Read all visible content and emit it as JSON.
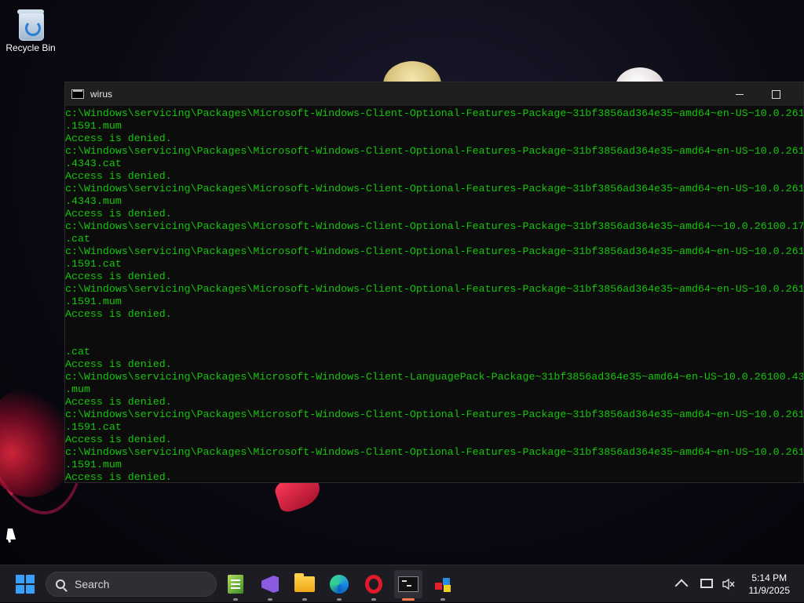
{
  "desktop": {
    "icons": [
      {
        "label": "Recycle Bin",
        "icon": "recycle-bin-icon"
      }
    ]
  },
  "window": {
    "title": "wirus",
    "icon": "console-icon",
    "lines": [
      "c:\\Windows\\servicing\\Packages\\Microsoft-Windows-Client-Optional-Features-Package~31bf3856ad364e35~amd64~en-US~10.0.261",
      ".1591.mum",
      "Access is denied.",
      "c:\\Windows\\servicing\\Packages\\Microsoft-Windows-Client-Optional-Features-Package~31bf3856ad364e35~amd64~en-US~10.0.261",
      ".4343.cat",
      "Access is denied.",
      "c:\\Windows\\servicing\\Packages\\Microsoft-Windows-Client-Optional-Features-Package~31bf3856ad364e35~amd64~en-US~10.0.261",
      ".4343.mum",
      "Access is denied.",
      "c:\\Windows\\servicing\\Packages\\Microsoft-Windows-Client-Optional-Features-Package~31bf3856ad364e35~amd64~~10.0.26100.17",
      ".cat",
      "c:\\Windows\\servicing\\Packages\\Microsoft-Windows-Client-Optional-Features-Package~31bf3856ad364e35~amd64~en-US~10.0.261",
      ".1591.cat",
      "Access is denied.",
      "c:\\Windows\\servicing\\Packages\\Microsoft-Windows-Client-Optional-Features-Package~31bf3856ad364e35~amd64~en-US~10.0.261",
      ".1591.mum",
      "Access is denied.",
      "",
      "",
      ".cat",
      "Access is denied.",
      "c:\\Windows\\servicing\\Packages\\Microsoft-Windows-Client-LanguagePack-Package~31bf3856ad364e35~amd64~en-US~10.0.26100.43",
      ".mum",
      "Access is denied.",
      "c:\\Windows\\servicing\\Packages\\Microsoft-Windows-Client-Optional-Features-Package~31bf3856ad364e35~amd64~en-US~10.0.261",
      ".1591.cat",
      "Access is denied.",
      "c:\\Windows\\servicing\\Packages\\Microsoft-Windows-Client-Optional-Features-Package~31bf3856ad364e35~amd64~en-US~10.0.261",
      ".1591.mum",
      "Access is denied."
    ],
    "colors": {
      "text": "#16c60c",
      "background": "#0c0c0c"
    }
  },
  "taskbar": {
    "search_placeholder": "Search",
    "apps": [
      {
        "name": "notepad-app",
        "icon": "notepad-icon"
      },
      {
        "name": "visual-studio-app",
        "icon": "visual-studio-icon"
      },
      {
        "name": "file-explorer-app",
        "icon": "folder-icon"
      },
      {
        "name": "edge-app",
        "icon": "edge-icon"
      },
      {
        "name": "opera-app",
        "icon": "opera-icon"
      },
      {
        "name": "terminal-app",
        "icon": "terminal-icon",
        "active": true
      },
      {
        "name": "game-app",
        "icon": "game-icon"
      }
    ],
    "clock": {
      "time": "5:14 PM",
      "date": "11/9/2025"
    },
    "accent": "#ff7a4a"
  }
}
